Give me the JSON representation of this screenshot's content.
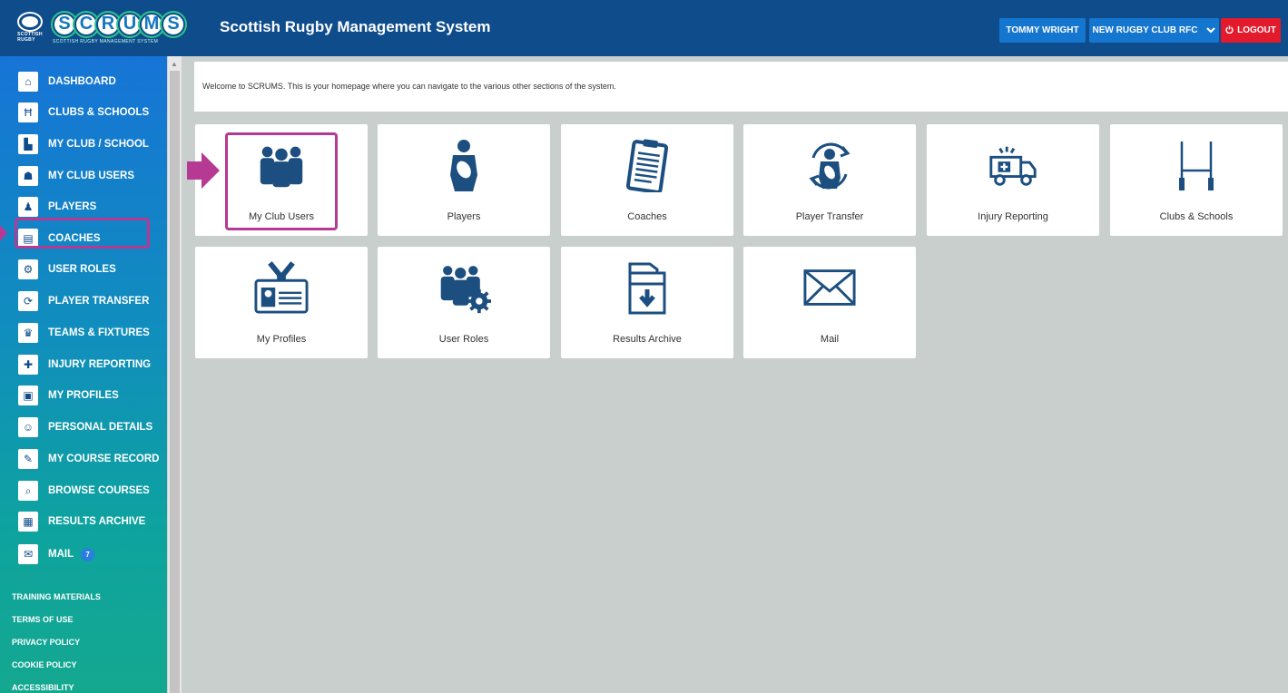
{
  "header": {
    "logo_text": "SCRUMS",
    "logo_sub": "SCOTTISH RUGBY MANAGEMENT SYSTEM",
    "title": "Scottish Rugby Management System",
    "user_button": "TOMMY WRIGHT",
    "club_button": "NEW RUGBY CLUB RFC",
    "logout_button": "LOGOUT"
  },
  "sidebar": {
    "items": [
      {
        "label": "DASHBOARD",
        "icon": "home-icon"
      },
      {
        "label": "CLUBS & SCHOOLS",
        "icon": "goalposts-icon"
      },
      {
        "label": "MY CLUB / SCHOOL",
        "icon": "building-icon"
      },
      {
        "label": "MY CLUB USERS",
        "icon": "users-icon"
      },
      {
        "label": "PLAYERS",
        "icon": "player-icon"
      },
      {
        "label": "COACHES",
        "icon": "clipboard-icon"
      },
      {
        "label": "USER ROLES",
        "icon": "user-roles-icon"
      },
      {
        "label": "PLAYER TRANSFER",
        "icon": "transfer-icon"
      },
      {
        "label": "TEAMS & FIXTURES",
        "icon": "trophy-icon"
      },
      {
        "label": "INJURY REPORTING",
        "icon": "ambulance-icon"
      },
      {
        "label": "MY PROFILES",
        "icon": "id-badge-icon"
      },
      {
        "label": "PERSONAL DETAILS",
        "icon": "person-card-icon"
      },
      {
        "label": "MY COURSE RECORD",
        "icon": "course-record-icon"
      },
      {
        "label": "BROWSE COURSES",
        "icon": "browse-icon"
      },
      {
        "label": "RESULTS ARCHIVE",
        "icon": "archive-icon"
      },
      {
        "label": "MAIL",
        "icon": "mail-icon",
        "badge": "7"
      }
    ],
    "footer_links": [
      "TRAINING MATERIALS",
      "TERMS OF USE",
      "PRIVACY POLICY",
      "COOKIE POLICY",
      "ACCESSIBILITY"
    ]
  },
  "main": {
    "welcome": "Welcome to SCRUMS. This is your homepage where you can navigate to the various other sections of the system.",
    "cards": [
      {
        "label": "My Club Users",
        "icon": "users-icon"
      },
      {
        "label": "Players",
        "icon": "player-icon"
      },
      {
        "label": "Coaches",
        "icon": "clipboard-icon"
      },
      {
        "label": "Player Transfer",
        "icon": "transfer-icon"
      },
      {
        "label": "Injury Reporting",
        "icon": "ambulance-icon"
      },
      {
        "label": "Clubs & Schools",
        "icon": "goalposts-icon"
      },
      {
        "label": "My Profiles",
        "icon": "id-badge-icon"
      },
      {
        "label": "User Roles",
        "icon": "user-roles-icon"
      },
      {
        "label": "Results Archive",
        "icon": "archive-icon"
      },
      {
        "label": "Mail",
        "icon": "mail-icon"
      }
    ]
  },
  "colors": {
    "header": "#0e4c8c",
    "accent": "#1576d0",
    "logout": "#e3192c",
    "highlight": "#b63a94",
    "icon": "#1c4f80"
  }
}
